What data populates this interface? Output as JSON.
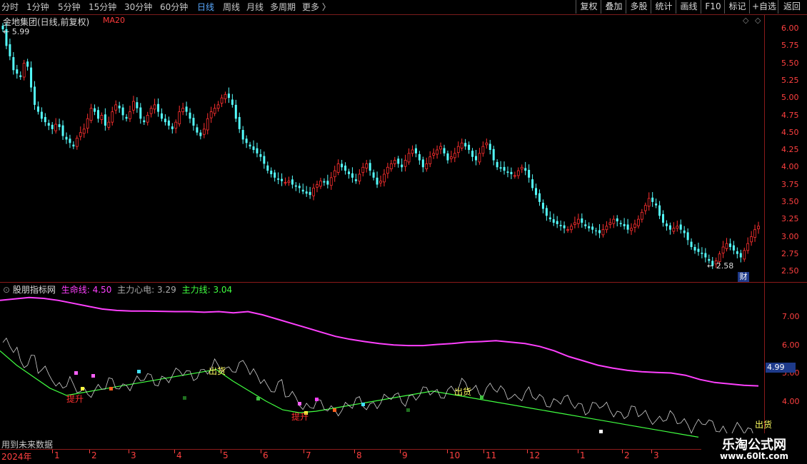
{
  "toolbar": {
    "periods": [
      "分时",
      "1分钟",
      "5分钟",
      "15分钟",
      "30分钟",
      "60分钟",
      "日线",
      "周线",
      "月线",
      "多周期",
      "更多 〉"
    ],
    "active_period": "日线",
    "buttons": [
      "复权",
      "叠加",
      "多股",
      "统计",
      "画线",
      "F10",
      "标记",
      "+自选",
      "返回"
    ]
  },
  "main_chart": {
    "title": "金地集团(日线,前复权)",
    "ma_label": "MA20",
    "high_marker": "5.99",
    "low_marker": "2.58",
    "scale": [
      "6.00",
      "5.75",
      "5.50",
      "5.25",
      "5.00",
      "4.75",
      "4.50",
      "4.25",
      "4.00",
      "3.75",
      "3.50",
      "3.25",
      "3.00",
      "2.75",
      "2.50"
    ],
    "finance_badge": "财"
  },
  "indicator": {
    "name": "股朋指标网",
    "life_line_label": "生命线:",
    "life_line_value": "4.50",
    "heart_label": "主力心电:",
    "heart_value": "3.29",
    "main_line_label": "主力线:",
    "main_line_value": "3.04",
    "scale": [
      "7.00",
      "6.00",
      "5.00",
      "4.00"
    ],
    "current_value": "4.99",
    "signal_up": "提升",
    "signal_out": "出货",
    "future_note": "用到未来数据"
  },
  "x_axis": {
    "year_label": "2024年",
    "months": [
      "1",
      "2",
      "3",
      "4",
      "5",
      "6",
      "7",
      "8",
      "9",
      "10",
      "11",
      "12",
      "1",
      "2",
      "3"
    ]
  },
  "watermark": {
    "title": "乐淘公式网",
    "url": "www.60lt.com"
  },
  "colors": {
    "up": "#ff3030",
    "down": "#54fcfc",
    "life_line": "#ff40ff",
    "main_line": "#40ff40",
    "heart": "#d0d0d0",
    "frame": "#8b1a1a"
  },
  "chart_data": {
    "type": "candlestick",
    "closes": [
      5.99,
      5.75,
      5.6,
      5.4,
      5.35,
      5.3,
      5.5,
      5.45,
      5.15,
      4.9,
      4.8,
      4.7,
      4.65,
      4.6,
      4.55,
      4.62,
      4.58,
      4.45,
      4.4,
      4.35,
      4.3,
      4.42,
      4.5,
      4.55,
      4.7,
      4.85,
      4.8,
      4.7,
      4.75,
      4.6,
      4.65,
      4.8,
      4.9,
      4.85,
      4.75,
      4.7,
      4.8,
      4.95,
      4.85,
      4.7,
      4.65,
      4.75,
      4.85,
      4.9,
      4.8,
      4.7,
      4.65,
      4.6,
      4.55,
      4.65,
      4.8,
      4.85,
      4.8,
      4.7,
      4.6,
      4.5,
      4.45,
      4.55,
      4.7,
      4.8,
      4.85,
      4.9,
      5.0,
      5.05,
      5.0,
      4.9,
      4.7,
      4.55,
      4.4,
      4.35,
      4.3,
      4.25,
      4.2,
      4.15,
      4.05,
      3.95,
      3.9,
      3.85,
      3.82,
      3.8,
      3.78,
      3.8,
      3.75,
      3.72,
      3.7,
      3.65,
      3.62,
      3.6,
      3.7,
      3.75,
      3.8,
      3.78,
      3.75,
      3.85,
      3.95,
      4.05,
      4.0,
      3.95,
      3.9,
      3.85,
      3.8,
      3.9,
      4.0,
      4.05,
      3.95,
      3.85,
      3.75,
      3.8,
      3.9,
      4.0,
      4.05,
      4.1,
      4.05,
      4.0,
      4.1,
      4.2,
      4.25,
      4.2,
      4.1,
      4.0,
      4.05,
      4.15,
      4.2,
      4.25,
      4.3,
      4.2,
      4.1,
      4.15,
      4.2,
      4.3,
      4.35,
      4.3,
      4.25,
      4.15,
      4.1,
      4.2,
      4.3,
      4.35,
      4.25,
      4.1,
      4.0,
      3.98,
      3.95,
      3.92,
      3.9,
      3.88,
      3.95,
      4.0,
      3.95,
      3.85,
      3.7,
      3.6,
      3.5,
      3.4,
      3.3,
      3.25,
      3.2,
      3.18,
      3.15,
      3.12,
      3.1,
      3.15,
      3.2,
      3.25,
      3.2,
      3.15,
      3.12,
      3.1,
      3.08,
      3.05,
      3.1,
      3.15,
      3.2,
      3.25,
      3.22,
      3.18,
      3.15,
      3.1,
      3.12,
      3.18,
      3.25,
      3.35,
      3.45,
      3.55,
      3.5,
      3.45,
      3.3,
      3.2,
      3.15,
      3.1,
      3.12,
      3.15,
      3.1,
      3.05,
      2.95,
      2.85,
      2.8,
      2.78,
      2.75,
      2.7,
      2.65,
      2.58,
      2.65,
      2.75,
      2.85,
      2.9,
      2.85,
      2.8,
      2.75,
      2.7,
      2.8,
      2.9,
      3.0,
      3.1,
      3.15
    ],
    "ylim": [
      2.5,
      6.0
    ],
    "indicator": {
      "life_line": [
        7.55,
        7.6,
        7.65,
        7.62,
        7.55,
        7.45,
        7.35,
        7.25,
        7.2,
        7.18,
        7.18,
        7.17,
        7.16,
        7.16,
        7.14,
        7.16,
        7.12,
        7.16,
        7.05,
        6.9,
        6.75,
        6.6,
        6.45,
        6.3,
        6.2,
        6.12,
        6.05,
        6.0,
        5.98,
        5.98,
        6.02,
        6.05,
        6.1,
        6.12,
        6.15,
        6.1,
        6.05,
        5.95,
        5.8,
        5.6,
        5.45,
        5.3,
        5.2,
        5.12,
        5.07,
        5.05,
        5.03,
        4.95,
        4.8,
        4.7,
        4.65,
        4.6,
        4.58
      ],
      "main_line": [
        5.8,
        5.3,
        4.9,
        4.5,
        4.25,
        4.35,
        4.45,
        4.55,
        4.65,
        4.75,
        4.85,
        4.95,
        5.05,
        5.15,
        4.75,
        4.4,
        4.05,
        3.75,
        3.65,
        3.7,
        3.8,
        3.9,
        4.0,
        4.1,
        4.2,
        4.3,
        4.4,
        4.3,
        4.2,
        4.1,
        4.0,
        3.9,
        3.8,
        3.7,
        3.6,
        3.5,
        3.4,
        3.3,
        3.2,
        3.1,
        3.0,
        2.9,
        2.8
      ],
      "ylim": [
        2.7,
        8.0
      ]
    }
  }
}
